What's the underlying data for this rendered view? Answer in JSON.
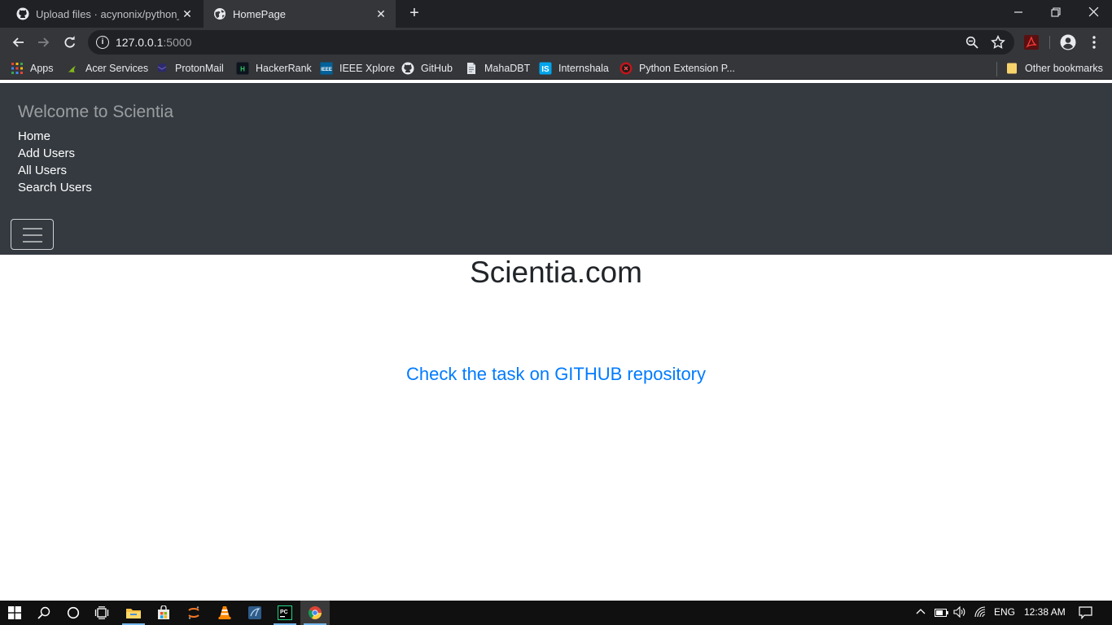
{
  "browser": {
    "tabs": [
      {
        "title": "Upload files · acynonix/python_fl",
        "favicon": "github-icon",
        "active": false
      },
      {
        "title": "HomePage",
        "favicon": "globe-icon",
        "active": true
      }
    ],
    "url_host": "127.0.0.1",
    "url_port": ":5000",
    "bookmarks": [
      {
        "label": "Apps",
        "icon": "apps-grid-icon"
      },
      {
        "label": "Acer Services",
        "icon": "acer-icon"
      },
      {
        "label": "ProtonMail",
        "icon": "protonmail-icon"
      },
      {
        "label": "HackerRank",
        "icon": "hackerrank-icon"
      },
      {
        "label": "IEEE Xplore",
        "icon": "ieee-icon"
      },
      {
        "label": "GitHub",
        "icon": "github-icon"
      },
      {
        "label": "MahaDBT",
        "icon": "document-icon"
      },
      {
        "label": "Internshala",
        "icon": "internshala-icon"
      },
      {
        "label": "Python Extension P...",
        "icon": "python-extension-icon"
      }
    ],
    "other_bookmarks": "Other bookmarks"
  },
  "site": {
    "brand": "Welcome to Scientia",
    "nav": [
      "Home",
      "Add Users",
      "All Users",
      "Search Users"
    ],
    "title": "Scientia.com",
    "link": "Check the task on GITHUB repository"
  },
  "taskbar": {
    "language": "ENG",
    "time": "12:38 AM"
  },
  "colors": {
    "navbar_bg": "#343a40",
    "link": "#007bff",
    "chrome_dark": "#202124",
    "chrome_toolbar": "#35363a"
  }
}
